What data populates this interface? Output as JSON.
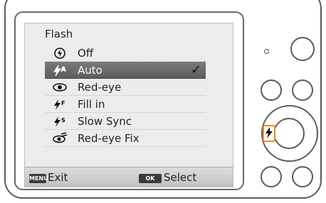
{
  "screen": {
    "title": "Flash",
    "items": [
      {
        "icon": "flash-off-icon",
        "label": "Off",
        "selected": false
      },
      {
        "icon": "flash-auto-icon",
        "label": "Auto",
        "selected": true
      },
      {
        "icon": "red-eye-icon",
        "label": "Red-eye",
        "selected": false
      },
      {
        "icon": "fill-in-flash-icon",
        "label": "Fill in",
        "selected": false
      },
      {
        "icon": "slow-sync-icon",
        "label": "Slow Sync",
        "selected": false
      },
      {
        "icon": "red-eye-fix-icon",
        "label": "Red-eye Fix",
        "selected": false
      }
    ],
    "check_mark": "✓",
    "bottom_bar": {
      "menu_key": "MENU",
      "exit_label": "Exit",
      "ok_key": "OK",
      "select_label": "Select"
    }
  },
  "colors": {
    "highlight": "#f08a1e",
    "selected_row": "#666666"
  }
}
